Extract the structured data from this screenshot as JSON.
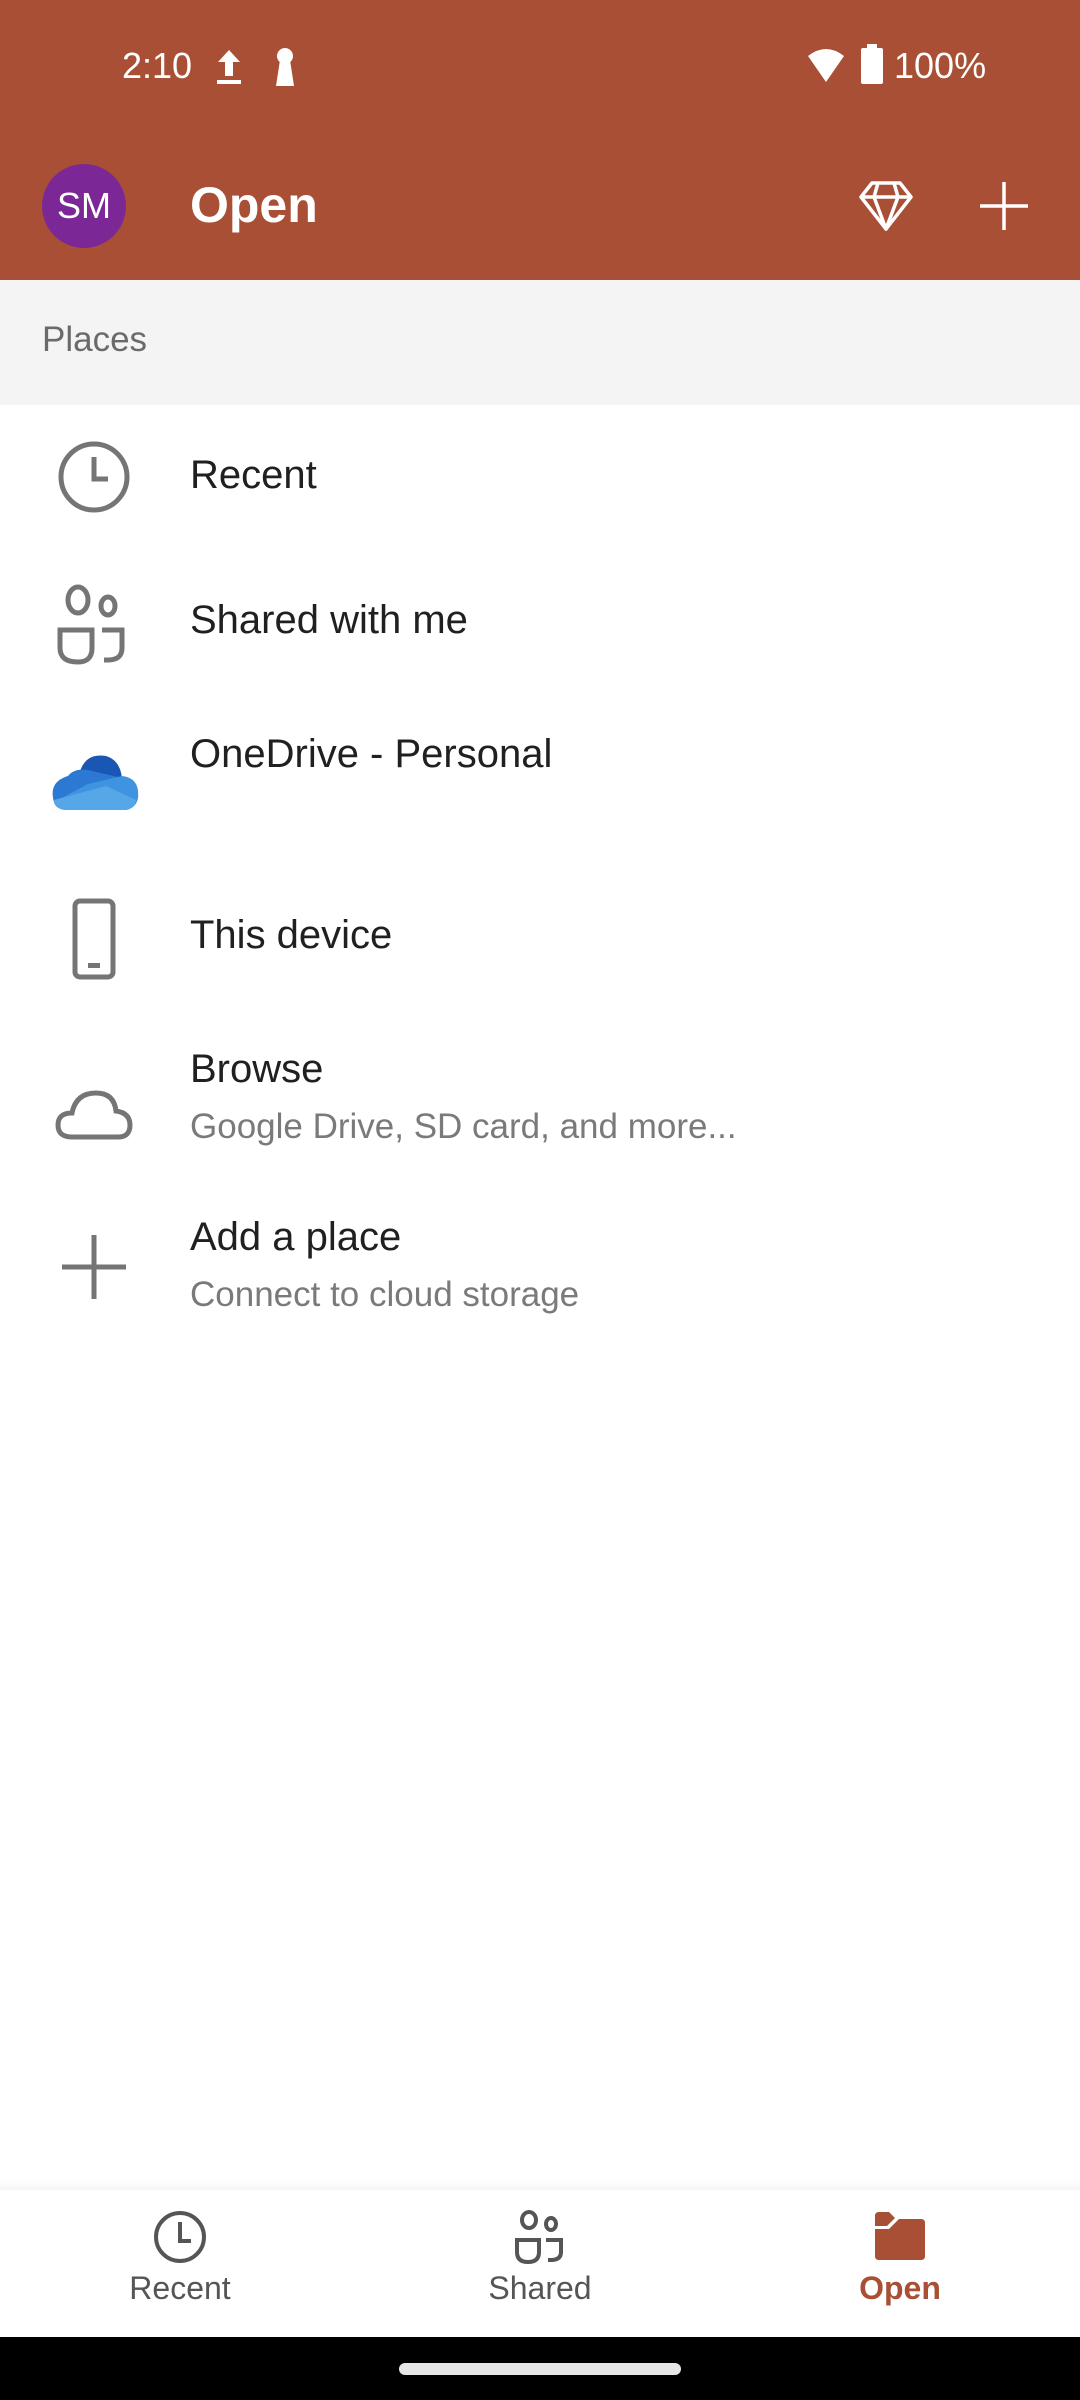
{
  "status_bar": {
    "time": "2:10",
    "battery": "100%",
    "icons": [
      "upload-icon",
      "keyhole-icon",
      "wifi-icon",
      "battery-icon"
    ]
  },
  "header": {
    "avatar_initials": "SM",
    "title": "Open",
    "actions": [
      "premium-diamond-icon",
      "new-plus-icon"
    ]
  },
  "colors": {
    "accent": "#A84F35",
    "avatar": "#7B2896",
    "onedrive_blue": "#1F6FD0"
  },
  "places": {
    "heading": "Places",
    "items": [
      {
        "label": "Recent",
        "sublabel": null,
        "icon": "clock-icon"
      },
      {
        "label": "Shared with me",
        "sublabel": null,
        "icon": "people-icon"
      },
      {
        "label": "OneDrive - Personal",
        "sublabel": null,
        "icon": "onedrive-icon"
      },
      {
        "label": "This device",
        "sublabel": null,
        "icon": "phone-icon"
      },
      {
        "label": "Browse",
        "sublabel": "Google Drive, SD card, and more...",
        "icon": "cloud-outline-icon"
      },
      {
        "label": "Add a place",
        "sublabel": "Connect to cloud storage",
        "icon": "plus-icon"
      }
    ]
  },
  "bottom_nav": {
    "tabs": [
      {
        "label": "Recent",
        "icon": "clock-icon",
        "active": false
      },
      {
        "label": "Shared",
        "icon": "people-icon",
        "active": false
      },
      {
        "label": "Open",
        "icon": "folder-icon",
        "active": true
      }
    ]
  }
}
